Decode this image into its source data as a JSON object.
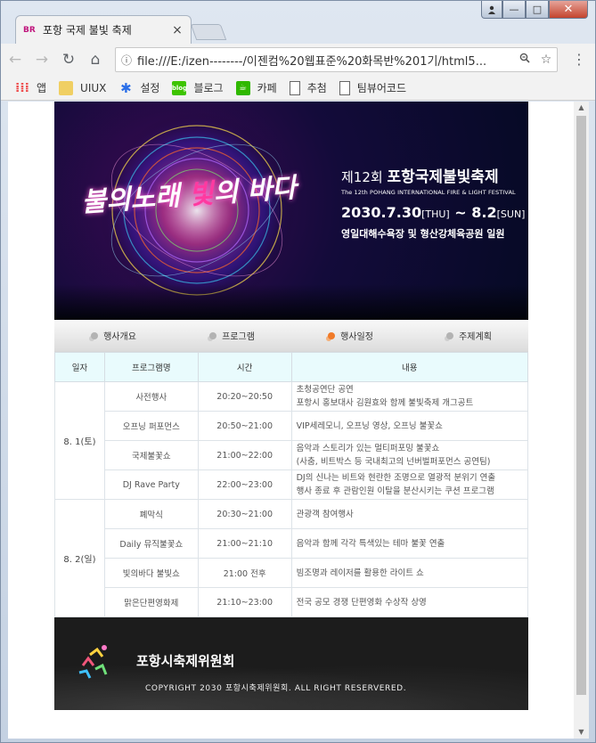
{
  "browser": {
    "tab_title": "포항 국제 불빛 축제",
    "favicon_text": "BR",
    "tab_close": "×",
    "url": "file:///E:/izen--------/이젠컴%20웹표준%20화목반%201기/html5...",
    "window_controls": {
      "minimize": "—",
      "maximize": "□",
      "close": "✕"
    }
  },
  "bookmarks": [
    {
      "icon": "apps-icon",
      "label": "앱"
    },
    {
      "icon": "folder-icon",
      "label": "UIUX"
    },
    {
      "icon": "gear-icon",
      "label": "설정"
    },
    {
      "icon": "blog-icon",
      "label": "블로그",
      "badge": "blog"
    },
    {
      "icon": "cafe-icon",
      "label": "카페"
    },
    {
      "icon": "doc-icon",
      "label": "추첨"
    },
    {
      "icon": "doc-icon",
      "label": "팀뷰어코드"
    }
  ],
  "hero": {
    "calligraphy_a": "불의노래",
    "calligraphy_b": "빛",
    "calligraphy_c": "의 바다",
    "edition_prefix": "제12회",
    "edition_title": "포항국제불빛축제",
    "english": "The 12th POHANG INTERNATIONAL FIRE & LIGHT FESTIVAL",
    "date_start": "2030.7.30",
    "date_start_day": "[THU]",
    "date_sep": "~",
    "date_end": "8.2",
    "date_end_day": "[SUN]",
    "venue": "영일대해수욕장 및 형산강체육공원 일원"
  },
  "nav": [
    {
      "label": "행사개요",
      "active": false
    },
    {
      "label": "프로그램",
      "active": false
    },
    {
      "label": "행사일정",
      "active": true
    },
    {
      "label": "주제계획",
      "active": false
    }
  ],
  "schedule": {
    "headers": [
      "일자",
      "프로그램명",
      "시간",
      "내용"
    ],
    "days": [
      {
        "date": "8. 1(토)",
        "rows": [
          {
            "program": "사전행사",
            "time": "20:20~20:50",
            "desc": [
              "초청공연단 공연",
              "포항시 홍보대사 김원효와 함께 불빛축제 개그공트"
            ]
          },
          {
            "program": "오프닝 퍼포먼스",
            "time": "20:50~21:00",
            "desc": [
              "VIP세레모니, 오프닝 영상, 오프닝 불꽃쇼"
            ]
          },
          {
            "program": "국제불꽃쇼",
            "time": "21:00~22:00",
            "desc": [
              "음악과 스토리가 있는 멀티퍼포밍 불꽃쇼",
              "(사춤, 비트박스 등 국내최고의 넌버벌퍼포먼스 공연팀)"
            ]
          },
          {
            "program": "DJ Rave Party",
            "time": "22:00~23:00",
            "desc": [
              "DJ의 신나는 비트와 현란한 조명으로 열광적 분위기 연출",
              "행사 종료 후 관람인원 이탈을 분산시키는 쿠션 프로그램"
            ]
          }
        ]
      },
      {
        "date": "8. 2(일)",
        "rows": [
          {
            "program": "폐막식",
            "time": "20:30~21:00",
            "desc": [
              "관광객 참여행사"
            ]
          },
          {
            "program": "Daily 뮤직불꽃쇼",
            "time": "21:00~21:10",
            "desc": [
              "음악과 함께 각각 특색있는 테마 불꽃 연출"
            ]
          },
          {
            "program": "빛의바다 불빛쇼",
            "time": "21:00 전후",
            "desc": [
              "빔조명과 레이저를 활용한 라이트 쇼"
            ]
          },
          {
            "program": "맑은단편영화제",
            "time": "21:10~23:00",
            "desc": [
              "전국 공모 경쟁 단편영화 수상작 상영"
            ]
          }
        ]
      }
    ]
  },
  "footer": {
    "org": "포항시축제위원회",
    "copyright": "COPYRIGHT 2030 포항시축제위원회. ALL RIGHT RESERVERED."
  },
  "colors": {
    "header_cell_bg": "#e9fbfd",
    "active_nav_dot": "#f07a28",
    "footer_bg": "#1c1c1c",
    "close_button": "#c4442e"
  }
}
